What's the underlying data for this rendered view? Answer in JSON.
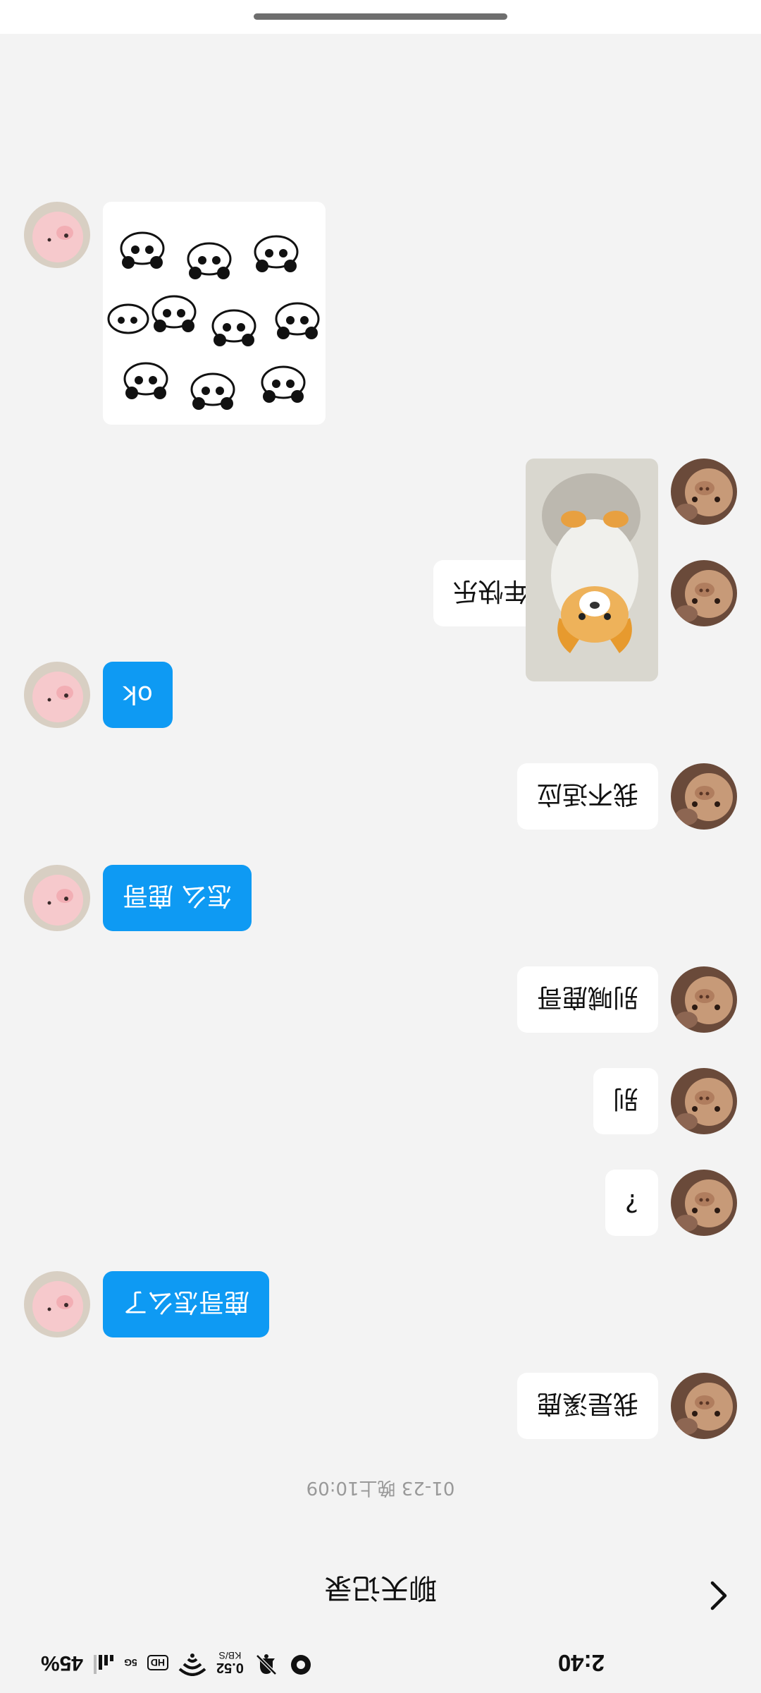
{
  "status_bar": {
    "time": "2:40",
    "net_speed": "0.52",
    "net_speed_unit": "KB/S",
    "hd_label": "HD",
    "network_label": "5G",
    "battery": "45%"
  },
  "header": {
    "back_icon": "chevron-left-icon",
    "title": "聊天记录"
  },
  "chat": {
    "timestamp": "01-23 晚上10:09",
    "messages": [
      {
        "side": "left",
        "text": "我是溪鹿"
      },
      {
        "side": "right",
        "text": "鹿哥怎么了"
      },
      {
        "side": "left",
        "text": "?"
      },
      {
        "side": "left",
        "text": "别"
      },
      {
        "side": "left",
        "text": "别喊鹿哥"
      },
      {
        "side": "right",
        "text": "怎么 鹿哥"
      },
      {
        "side": "left",
        "text": "我不适应"
      },
      {
        "side": "right",
        "text": "ok"
      },
      {
        "side": "left",
        "text": "没怎么 新年快乐"
      },
      {
        "side": "left",
        "type": "sticker",
        "icon": "corgi-sticker-icon"
      },
      {
        "side": "right",
        "type": "sticker",
        "icon": "panda-sticker-icon"
      }
    ]
  },
  "colors": {
    "background": "#f3f3f3",
    "bubble_self": "#ffffff",
    "bubble_other": "#0e9af3",
    "timestamp": "#999999"
  }
}
